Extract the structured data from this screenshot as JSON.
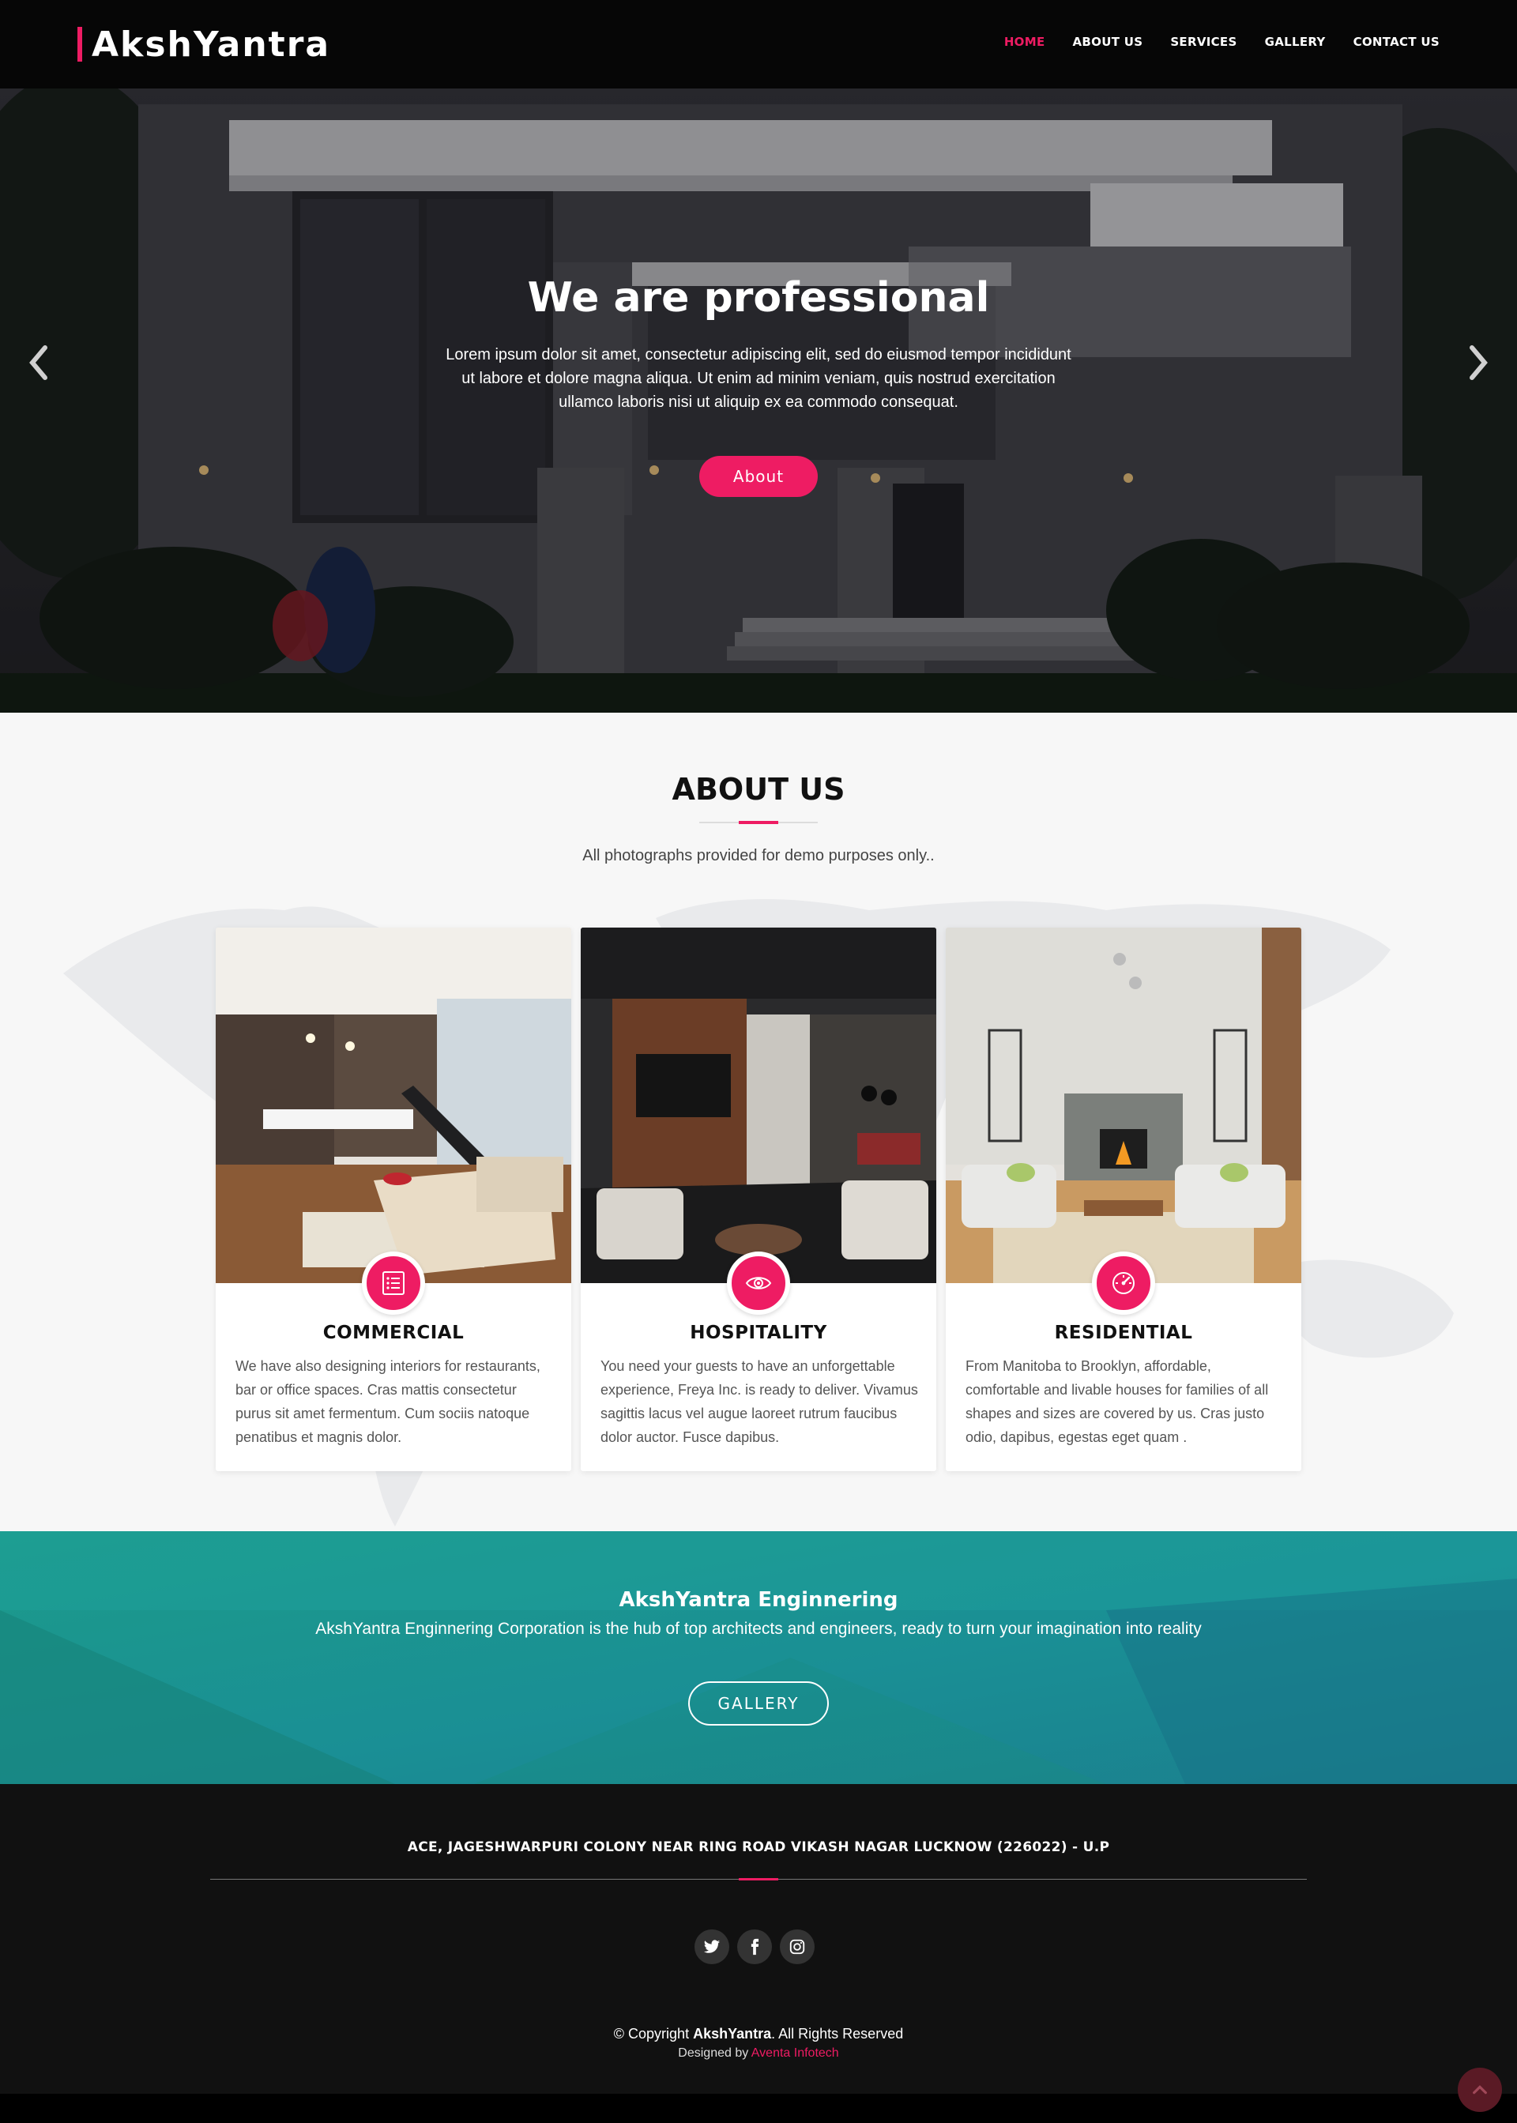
{
  "brand": {
    "name": "AkshYantra",
    "accent_color": "#ee1c63"
  },
  "nav": {
    "items": [
      {
        "label": "HOME",
        "active": true
      },
      {
        "label": "ABOUT US",
        "active": false
      },
      {
        "label": "SERVICES",
        "active": false
      },
      {
        "label": "GALLERY",
        "active": false
      },
      {
        "label": "CONTACT US",
        "active": false
      }
    ]
  },
  "hero": {
    "title": "We are professional",
    "text": "Lorem ipsum dolor sit amet, consectetur adipiscing elit, sed do eiusmod tempor incididunt ut labore et dolore magna aliqua. Ut enim ad minim veniam, quis nostrud exercitation ullamco laboris nisi ut aliquip ex ea commodo consequat.",
    "button_label": "About",
    "prev_icon": "chevron-left-icon",
    "next_icon": "chevron-right-icon"
  },
  "about": {
    "title": "ABOUT US",
    "subtitle": "All photographs provided for demo purposes only..",
    "cards": [
      {
        "title": "COMMERCIAL",
        "icon": "list-icon",
        "text": "We have also designing interiors for restaurants, bar or office spaces. Cras mattis consectetur purus sit amet fermentum. Cum sociis natoque penatibus et magnis dolor."
      },
      {
        "title": "HOSPITALITY",
        "icon": "eye-icon",
        "text": "You need your guests to have an unforgettable experience, Freya Inc. is ready to deliver. Vivamus sagittis lacus vel augue laoreet rutrum faucibus dolor auctor. Fusce dapibus."
      },
      {
        "title": "RESIDENTIAL",
        "icon": "gauge-icon",
        "text": "From Manitoba to Brooklyn, affordable, comfortable and livable houses for families of all shapes and sizes are covered by us. Cras justo odio, dapibus, egestas eget quam ."
      }
    ]
  },
  "cta": {
    "title": "AkshYantra Enginnering",
    "text": "AkshYantra Enginnering Corporation is the hub of top architects and engineers, ready to turn your imagination into reality",
    "button_label": "GALLERY"
  },
  "footer": {
    "address": "ACE, JAGESHWARPURI COLONY NEAR RING ROAD VIKASH NAGAR LUCKNOW (226022) - U.P",
    "socials": [
      "twitter-icon",
      "facebook-icon",
      "instagram-icon"
    ],
    "copyright_prefix": "© Copyright",
    "copyright_brand": "AkshYantra",
    "copyright_suffix": ". All Rights Reserved",
    "designed_prefix": "Designed by",
    "designed_link": "Aventa Infotech",
    "to_top_icon": "chevron-up-icon"
  }
}
